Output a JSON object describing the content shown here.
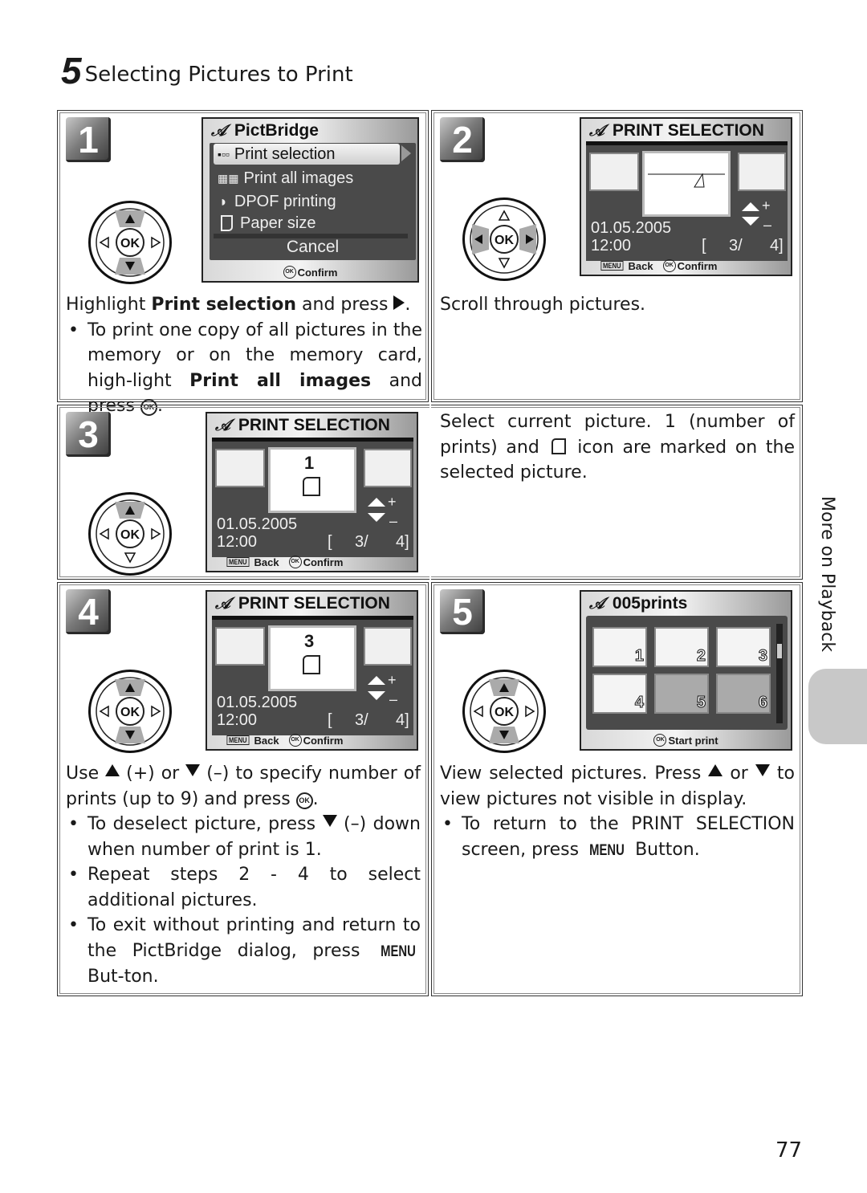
{
  "section": {
    "number": "5",
    "title": "Selecting Pictures to Print"
  },
  "side_tab": {
    "label": "More on Playback",
    "tab_color": "#c8c8c8"
  },
  "page_number": "77",
  "dpad": {
    "ok_label": "OK"
  },
  "steps": [
    {
      "number": "1",
      "screen": {
        "title": "PictBridge",
        "menu_items": [
          {
            "icon": "print-selection-icon",
            "label": "Print selection",
            "selected": true
          },
          {
            "icon": "print-all-icon",
            "label": "Print all images",
            "selected": false
          },
          {
            "icon": "dpof-icon",
            "label": "DPOF printing",
            "selected": false
          },
          {
            "icon": "paper-size-icon",
            "label": "Paper size",
            "selected": false
          }
        ],
        "cancel_label": "Cancel",
        "footer_ok": "OK",
        "footer_label": "Confirm"
      },
      "text": {
        "intro_a": "Highlight ",
        "intro_bold": "Print selection",
        "intro_b": " and press",
        "bullet_a": "To print one copy of all pictures in the memory or on the memory card, high-light ",
        "bullet_bold": "Print all images",
        "bullet_b": " and press"
      }
    },
    {
      "number": "2",
      "screen": {
        "title": "PRINT SELECTION",
        "date": "01.05.2005",
        "time": "12:00",
        "counter_open": "[",
        "counter_current": "3/",
        "counter_total": "4]",
        "plus": "+",
        "minus": "–",
        "footer_menu": "MENU",
        "footer_back": "Back",
        "footer_ok": "OK",
        "footer_confirm": "Confirm"
      },
      "text": "Scroll through pictures."
    },
    {
      "number": "3",
      "screen": {
        "title": "PRINT SELECTION",
        "print_count": "1",
        "date": "01.05.2005",
        "time": "12:00",
        "counter_open": "[",
        "counter_current": "3/",
        "counter_total": "4]",
        "plus": "+",
        "minus": "–",
        "footer_menu": "MENU",
        "footer_back": "Back",
        "footer_ok": "OK",
        "footer_confirm": "Confirm"
      },
      "text": {
        "a": "Select current picture. 1 (number of prints) and",
        "b": "icon are marked on the selected picture."
      }
    },
    {
      "number": "4",
      "screen": {
        "title": "PRINT SELECTION",
        "print_count": "3",
        "date": "01.05.2005",
        "time": "12:00",
        "counter_open": "[",
        "counter_current": "3/",
        "counter_total": "4]",
        "plus": "+",
        "minus": "–",
        "footer_menu": "MENU",
        "footer_back": "Back",
        "footer_ok": "OK",
        "footer_confirm": "Confirm"
      },
      "text": {
        "use": "Use",
        "plus_or": "(+) or",
        "minus_to": "(–) to specify number of prints (up to 9) and press",
        "bullet1_a": "To deselect picture, press",
        "bullet1_b": "(–) down when number of print is 1.",
        "bullet2": "Repeat steps 2 - 4 to select additional pictures.",
        "bullet3_a": "To exit without printing and return to the PictBridge dialog, press",
        "bullet3_menu": "MENU",
        "bullet3_b": "But-ton."
      }
    },
    {
      "number": "5",
      "screen": {
        "title": "005prints",
        "thumbnails": [
          {
            "label": "1",
            "has_image": true
          },
          {
            "label": "2",
            "has_image": true
          },
          {
            "label": "3",
            "has_image": true
          },
          {
            "label": "4",
            "has_image": true
          },
          {
            "label": "5",
            "has_image": false
          },
          {
            "label": "6",
            "has_image": false
          }
        ],
        "footer_ok": "OK",
        "footer_label": "Start print"
      },
      "text": {
        "a": "View selected pictures. Press",
        "or": "or",
        "b": "to view pictures not visible in display.",
        "bullet_a": "To return to the PRINT SELECTION screen, press",
        "bullet_menu": "MENU",
        "bullet_b": "Button."
      }
    }
  ]
}
